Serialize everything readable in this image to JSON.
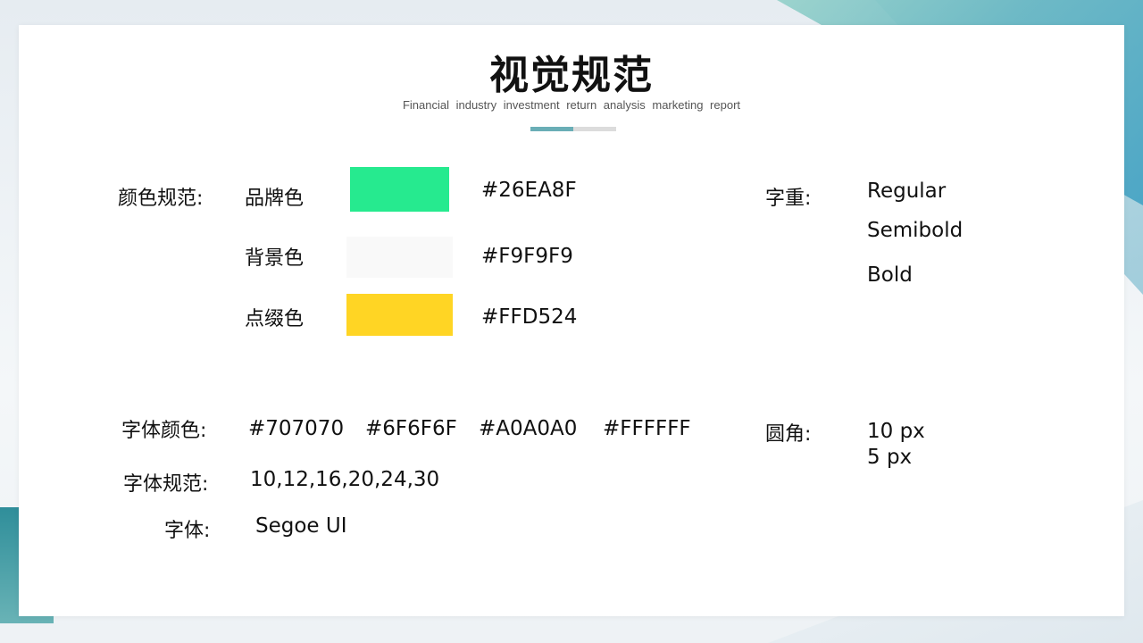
{
  "title": "视觉规范",
  "subtitle": "Financial industry investment return analysis marketing report",
  "colors": {
    "label": "颜色规范:",
    "items": [
      {
        "name": "品牌色",
        "hex": "#26EA8F",
        "swatch": "#26EA8F"
      },
      {
        "name": "背景色",
        "hex": "#F9F9F9",
        "swatch": "#F9F9F9"
      },
      {
        "name": "点缀色",
        "hex": "#FFD524",
        "swatch": "#FFD524"
      }
    ]
  },
  "weight": {
    "label": "字重:",
    "values": [
      "Regular",
      "Semibold",
      "Bold"
    ]
  },
  "font_color": {
    "label": "字体颜色:",
    "values": [
      "#707070",
      "#6F6F6F",
      "#A0A0A0",
      "#FFFFFF"
    ]
  },
  "radius": {
    "label": "圆角:",
    "values": [
      "10 px",
      "5 px"
    ]
  },
  "font_size": {
    "label": "字体规范:",
    "value": "10,12,16,20,24,30"
  },
  "font_family": {
    "label": "字体:",
    "value": "Segoe UI"
  },
  "theme": {
    "accent": "#6AAEB6",
    "decor_teal": "#3D9FC2"
  }
}
